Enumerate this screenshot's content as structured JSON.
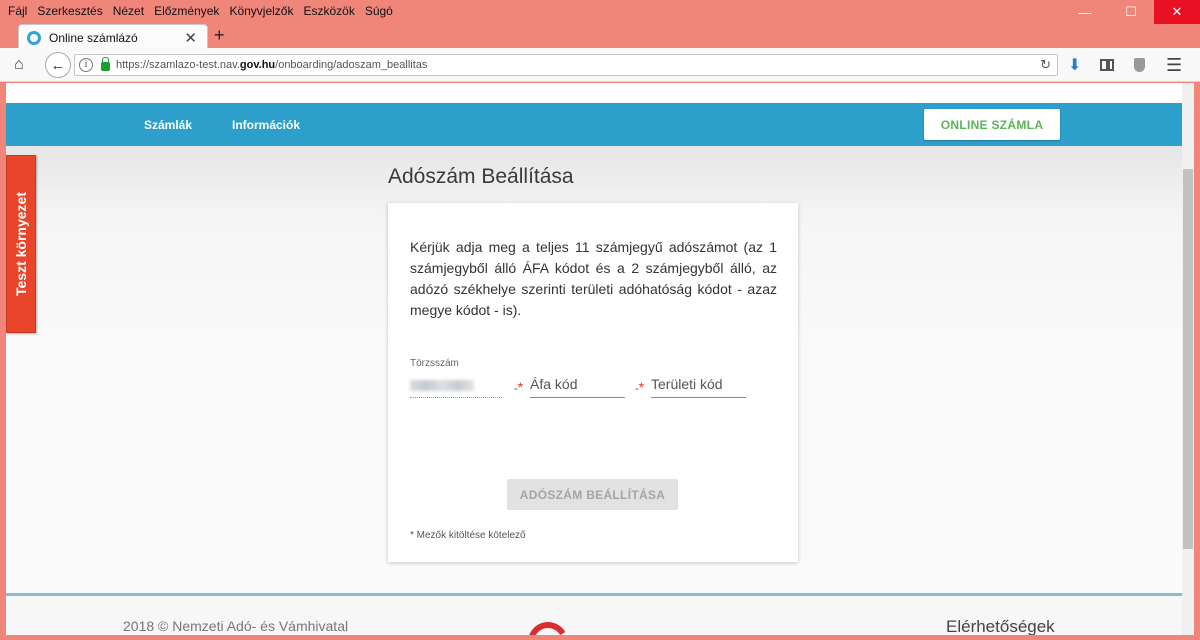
{
  "browser": {
    "menu": [
      "Fájl",
      "Szerkesztés",
      "Nézet",
      "Előzmények",
      "Könyvjelzők",
      "Eszközök",
      "Súgó"
    ],
    "tab_title": "Online számlázó",
    "url_prefix": "https://szamlazo-test.nav.",
    "url_domain": "gov.hu",
    "url_suffix": "/onboarding/adoszam_beallitas"
  },
  "site": {
    "nav": [
      "Számlák",
      "Információk"
    ],
    "online_button": "ONLINE SZÁMLA",
    "env_badge": "Teszt környezet"
  },
  "page": {
    "title": "Adószám Beállítása",
    "description": "Kérjük adja meg a teljes 11 számjegyű adószámot (az 1 számjegyből álló ÁFA kódot és a 2 számjegyből álló, az adózó székhelye szerinti területi adóhatóság kódot - azaz megye kódot - is).",
    "torzsszam_label": "Törzsszám",
    "separator": "-",
    "required_mark": "*",
    "afa_placeholder": "Áfa kód",
    "teruleti_placeholder": "Területi kód",
    "submit_label": "ADÓSZÁM BEÁLLÍTÁSA",
    "required_note": "* Mezők kitöltése kötelező"
  },
  "footer": {
    "copyright": "2018 © Nemzeti Adó- és Vámhivatal",
    "contacts_title": "Elérhetőségek"
  },
  "colors": {
    "header": "#2d9fcb",
    "accent_green": "#5bb35a",
    "env_badge": "#e8452a",
    "required": "#e0322b"
  }
}
